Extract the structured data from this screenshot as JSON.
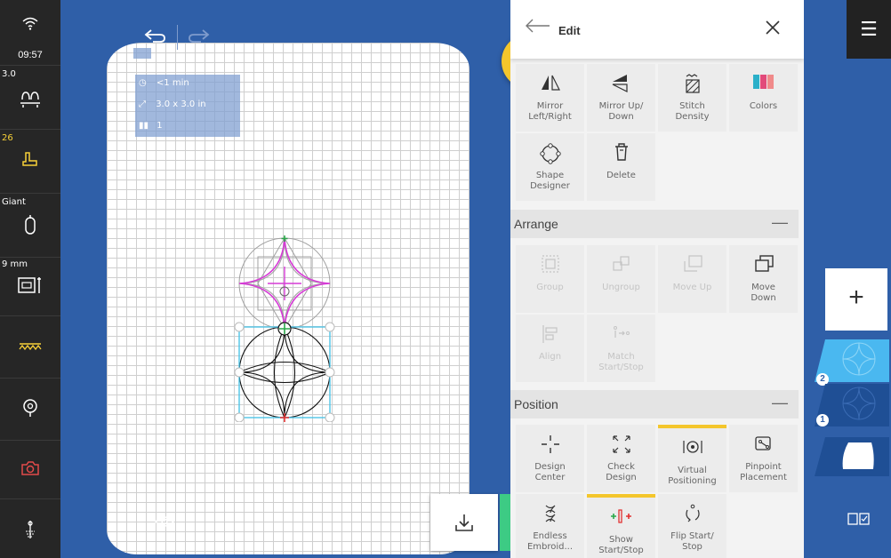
{
  "status": {
    "time": "09:57",
    "stitch_length": "3.0",
    "presser_foot": "26",
    "hoop": "Giant",
    "needle": "9 mm"
  },
  "canvas": {
    "info": {
      "time": "<1 min",
      "size": "3.0 x 3.0 in",
      "colors": "1"
    }
  },
  "panel": {
    "title": "Edit",
    "edit_tiles": [
      {
        "label": "Mirror\nLeft/Right",
        "icon": "mirror-left-right-icon"
      },
      {
        "label": "Mirror Up/\nDown",
        "icon": "mirror-up-down-icon"
      },
      {
        "label": "Stitch\nDensity",
        "icon": "stitch-density-icon"
      },
      {
        "label": "Colors",
        "icon": "colors-icon"
      },
      {
        "label": "Shape\nDesigner",
        "icon": "shape-designer-icon"
      },
      {
        "label": "Delete",
        "icon": "trash-icon"
      }
    ],
    "arrange": {
      "title": "Arrange",
      "tiles": [
        {
          "label": "Group",
          "icon": "group-icon"
        },
        {
          "label": "Ungroup",
          "icon": "ungroup-icon"
        },
        {
          "label": "Move Up",
          "icon": "move-up-icon"
        },
        {
          "label": "Move\nDown",
          "icon": "move-down-icon"
        },
        {
          "label": "Align",
          "icon": "align-icon"
        },
        {
          "label": "Match\nStart/Stop",
          "icon": "match-start-stop-icon"
        }
      ]
    },
    "position": {
      "title": "Position",
      "tiles": [
        {
          "label": "Design\nCenter",
          "icon": "design-center-icon"
        },
        {
          "label": "Check\nDesign",
          "icon": "check-design-icon"
        },
        {
          "label": "Virtual\nPositioning",
          "icon": "virtual-positioning-icon"
        },
        {
          "label": "Pinpoint\nPlacement",
          "icon": "pinpoint-placement-icon"
        },
        {
          "label": "Endless\nEmbroid...",
          "icon": "endless-embroidery-icon"
        },
        {
          "label": "Show\nStart/Stop",
          "icon": "show-start-stop-icon"
        },
        {
          "label": "Flip Start/\nStop",
          "icon": "flip-start-stop-icon"
        }
      ]
    }
  },
  "layers": [
    {
      "number": "2"
    },
    {
      "number": "1"
    }
  ],
  "colors": {
    "accent": "#f4c62c",
    "canvas_bg": "#2f5fa8",
    "stitch_green": "#3dcb84",
    "selection": "#4ec4e6",
    "magenta": "#d63ad6"
  }
}
